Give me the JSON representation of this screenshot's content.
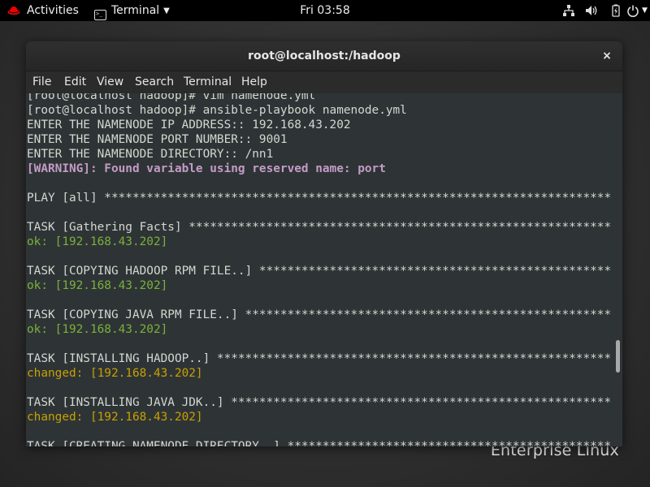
{
  "topbar": {
    "activities_label": "Activities",
    "app_menu_label": "Terminal",
    "clock": "Fri 03:58",
    "icons": [
      "redhat-icon",
      "terminal-icon",
      "network-icon",
      "volume-icon",
      "battery-icon",
      "power-icon"
    ]
  },
  "window": {
    "title": "root@localhost:/hadoop",
    "close_glyph": "×",
    "menu": [
      "File",
      "Edit",
      "View",
      "Search",
      "Terminal",
      "Help"
    ]
  },
  "terminal": {
    "lines": [
      {
        "text": "[root@localhost hadoop]# vim namenode.yml",
        "style": "normal"
      },
      {
        "text": "[root@localhost hadoop]# ansible-playbook namenode.yml",
        "style": "normal"
      },
      {
        "text": "ENTER THE NAMENODE IP ADDRESS:: 192.168.43.202",
        "style": "normal"
      },
      {
        "text": "ENTER THE NAMENODE PORT NUMBER:: 9001",
        "style": "normal"
      },
      {
        "text": "ENTER THE NAMENODE DIRECTORY:: /nn1",
        "style": "normal"
      },
      {
        "text": "[WARNING]: Found variable using reserved name: port",
        "style": "warn"
      },
      {
        "text": "",
        "style": "normal"
      },
      {
        "text": "PLAY [all] ***********************************************************************************",
        "style": "normal"
      },
      {
        "text": "",
        "style": "normal"
      },
      {
        "text": "TASK [Gathering Facts] ***********************************************************************",
        "style": "normal"
      },
      {
        "text": "ok: [192.168.43.202]",
        "style": "ok"
      },
      {
        "text": "",
        "style": "normal"
      },
      {
        "text": "TASK [COPYING HADOOP RPM FILE..] *************************************************************",
        "style": "normal"
      },
      {
        "text": "ok: [192.168.43.202]",
        "style": "ok"
      },
      {
        "text": "",
        "style": "normal"
      },
      {
        "text": "TASK [COPYING JAVA RPM FILE..] ***************************************************************",
        "style": "normal"
      },
      {
        "text": "ok: [192.168.43.202]",
        "style": "ok"
      },
      {
        "text": "",
        "style": "normal"
      },
      {
        "text": "TASK [INSTALLING HADOOP..] *******************************************************************",
        "style": "normal"
      },
      {
        "text": "changed: [192.168.43.202]",
        "style": "changed"
      },
      {
        "text": "",
        "style": "normal"
      },
      {
        "text": "TASK [INSTALLING JAVA JDK..] *****************************************************************",
        "style": "normal"
      },
      {
        "text": "changed: [192.168.43.202]",
        "style": "changed"
      },
      {
        "text": "",
        "style": "normal"
      },
      {
        "text": "TASK [CREATING NAMENODE DIRECTORY..] *********************************************************",
        "style": "normal"
      }
    ]
  },
  "desktop": {
    "branding": "Enterprise Linux"
  },
  "colors": {
    "terminal_bg": "#2e3436",
    "warning": "#c49bc6",
    "ok": "#7bb13a",
    "changed": "#c8a000"
  }
}
